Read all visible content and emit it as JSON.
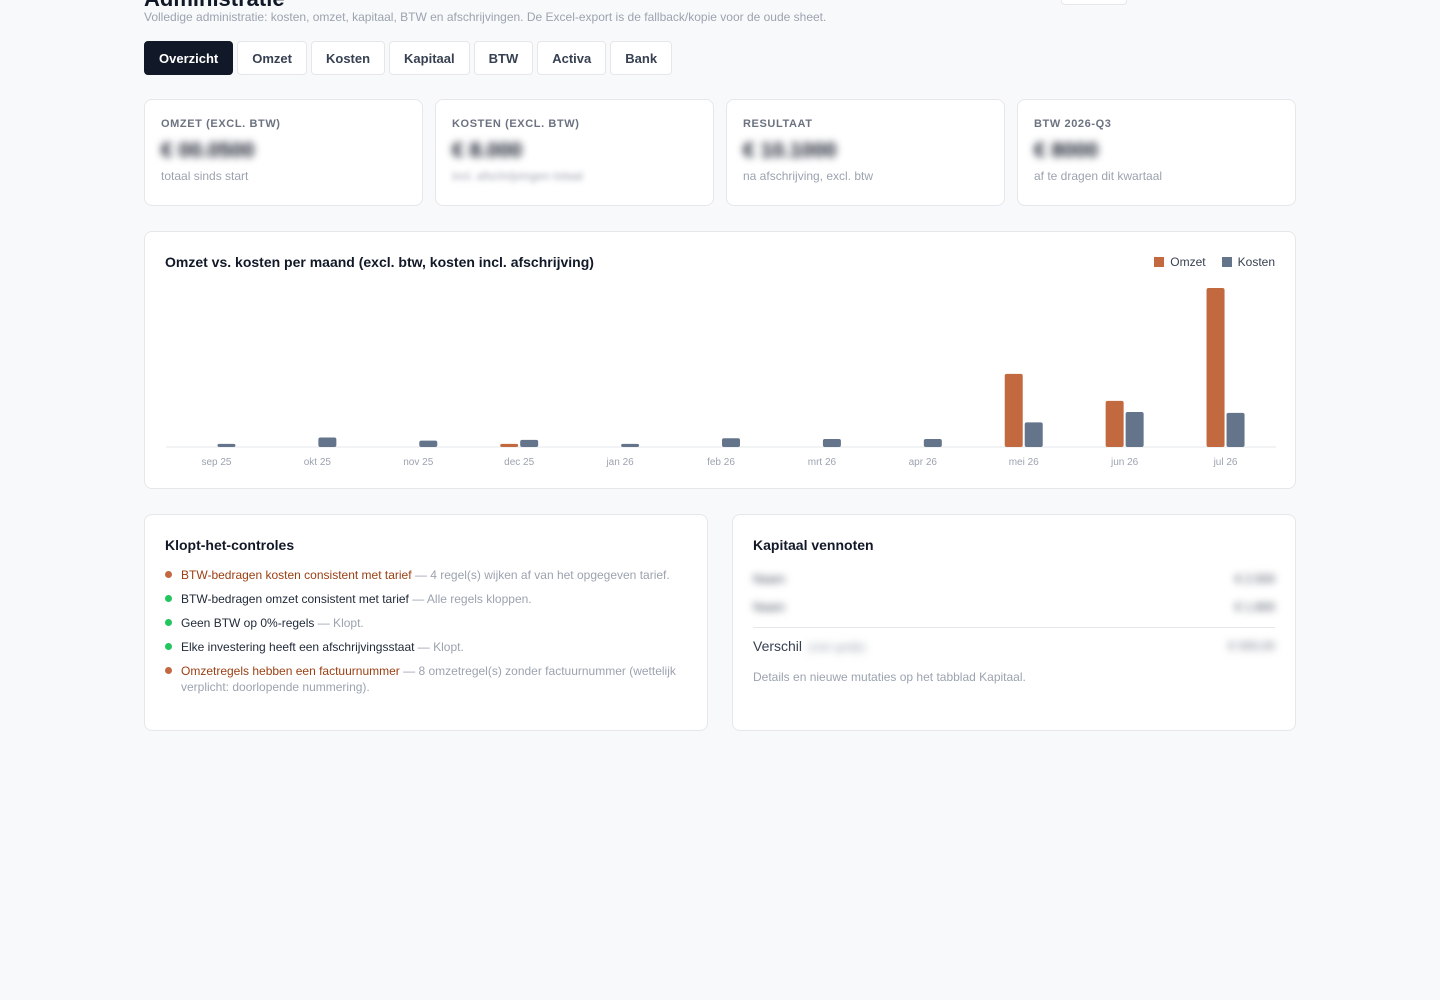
{
  "header": {
    "subtitle": "Volledige administratie: kosten, omzet, kapitaal, BTW en afschrijvingen. De Excel-export is de fallback/kopie voor de oude sheet."
  },
  "tabs": [
    {
      "label": "Overzicht",
      "active": true
    },
    {
      "label": "Omzet",
      "active": false
    },
    {
      "label": "Kosten",
      "active": false
    },
    {
      "label": "Kapitaal",
      "active": false
    },
    {
      "label": "BTW",
      "active": false
    },
    {
      "label": "Activa",
      "active": false
    },
    {
      "label": "Bank",
      "active": false
    }
  ],
  "kpis": [
    {
      "label": "OMZET (EXCL. BTW)",
      "value": "€ 00.0500",
      "sub": "totaal sinds start"
    },
    {
      "label": "KOSTEN (EXCL. BTW)",
      "value": "€ 8.000",
      "sub": "incl. afschrijvingen totaal"
    },
    {
      "label": "RESULTAAT",
      "value": "€ 10.1000",
      "sub": "na afschrijving, excl. btw"
    },
    {
      "label": "BTW 2026-Q3",
      "value": "€ 8000",
      "sub": "af te dragen dit kwartaal"
    }
  ],
  "chart": {
    "title": "Omzet vs. kosten per maand (excl. btw, kosten incl. afschrijving)",
    "legend": [
      {
        "name": "Omzet",
        "color": "#c2693f"
      },
      {
        "name": "Kosten",
        "color": "#64748b"
      }
    ]
  },
  "chart_data": {
    "type": "bar",
    "title": "Omzet vs. kosten per maand (excl. btw, kosten incl. afschrijving)",
    "categories": [
      "sep 25",
      "okt 25",
      "nov 25",
      "dec 25",
      "jan 26",
      "feb 26",
      "mrt 26",
      "apr 26",
      "mei 26",
      "jun 26",
      "jul 26"
    ],
    "series": [
      {
        "name": "Omzet",
        "color": "#c2693f",
        "values": [
          0,
          0,
          0,
          2,
          0,
          0,
          0,
          0,
          46,
          29,
          100
        ]
      },
      {
        "name": "Kosten",
        "color": "#64748b",
        "values": [
          2,
          6,
          4,
          4.5,
          2,
          5.5,
          5,
          5,
          15.5,
          22,
          21.5
        ]
      }
    ],
    "ylim": [
      0,
      100
    ],
    "grid": false,
    "legend_position": "top-right"
  },
  "checks": {
    "title": "Klopt-het-controles",
    "items": [
      {
        "name": "BTW-bedragen kosten consistent met tarief",
        "detail": " — 4 regel(s) wijken af van het opgegeven tarief.",
        "status": "warn",
        "color": "#c2693f"
      },
      {
        "name": "BTW-bedragen omzet consistent met tarief",
        "detail": " — Alle regels kloppen.",
        "status": "ok",
        "color": "#22c55e"
      },
      {
        "name": "Geen BTW op 0%-regels",
        "detail": " — Klopt.",
        "status": "ok",
        "color": "#22c55e"
      },
      {
        "name": "Elke investering heeft een afschrijvingsstaat",
        "detail": " — Klopt.",
        "status": "ok",
        "color": "#22c55e"
      },
      {
        "name": "Omzetregels hebben een factuurnummer",
        "detail": " — 8 omzetregel(s) zonder factuurnummer (wettelijk verplicht: doorlopende nummering).",
        "status": "warn",
        "color": "#c2693f"
      }
    ]
  },
  "capital": {
    "title": "Kapitaal vennoten",
    "rows": [
      {
        "name": "Naam",
        "value": "€ 2.500"
      },
      {
        "name": "Naam",
        "value": "€ 1.800"
      }
    ],
    "total_label": "Verschil",
    "total_note": "(niet gelijk)",
    "total_value": "€ 000,00",
    "footer": "Details en nieuwe mutaties op het tabblad Kapitaal."
  }
}
